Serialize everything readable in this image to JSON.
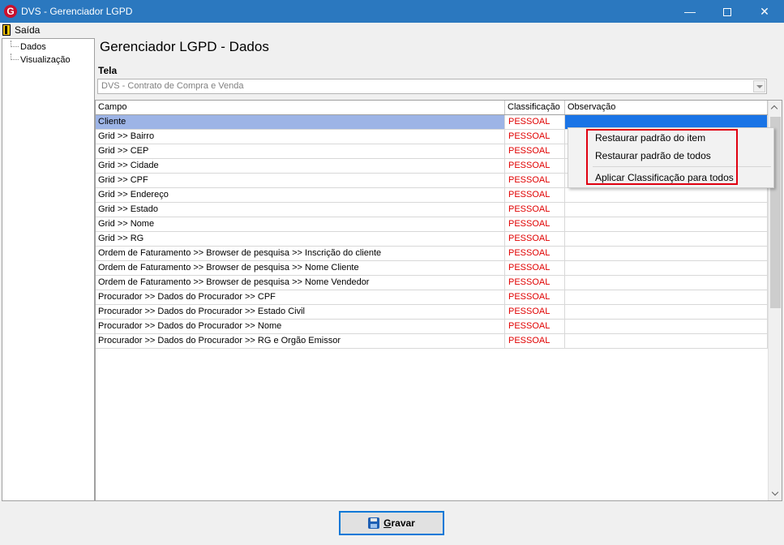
{
  "window": {
    "title": "DVS - Gerenciador LGPD",
    "app_icon_letter": "G",
    "minimize_glyph": "—",
    "close_glyph": "✕"
  },
  "menu": {
    "exit_label": "Saída"
  },
  "tree": {
    "items": [
      {
        "label": "Dados"
      },
      {
        "label": "Visualização"
      }
    ]
  },
  "main": {
    "heading": "Gerenciador LGPD - Dados",
    "tela_label": "Tela",
    "tela_value": "DVS - Contrato de Compra e Venda"
  },
  "grid": {
    "columns": [
      "Campo",
      "Classificação",
      "Observação"
    ],
    "rows": [
      {
        "campo": "Cliente",
        "classificacao": "PESSOAL",
        "observacao": ""
      },
      {
        "campo": "Grid >> Bairro",
        "classificacao": "PESSOAL",
        "observacao": ""
      },
      {
        "campo": "Grid >> CEP",
        "classificacao": "PESSOAL",
        "observacao": ""
      },
      {
        "campo": "Grid >> Cidade",
        "classificacao": "PESSOAL",
        "observacao": ""
      },
      {
        "campo": "Grid >> CPF",
        "classificacao": "PESSOAL",
        "observacao": ""
      },
      {
        "campo": "Grid >> Endereço",
        "classificacao": "PESSOAL",
        "observacao": ""
      },
      {
        "campo": "Grid >> Estado",
        "classificacao": "PESSOAL",
        "observacao": ""
      },
      {
        "campo": "Grid >> Nome",
        "classificacao": "PESSOAL",
        "observacao": ""
      },
      {
        "campo": "Grid >> RG",
        "classificacao": "PESSOAL",
        "observacao": ""
      },
      {
        "campo": "Ordem de Faturamento >> Browser de pesquisa >> Inscrição do cliente",
        "classificacao": "PESSOAL",
        "observacao": ""
      },
      {
        "campo": "Ordem de Faturamento >> Browser de pesquisa >> Nome Cliente",
        "classificacao": "PESSOAL",
        "observacao": ""
      },
      {
        "campo": "Ordem de Faturamento >> Browser de pesquisa >> Nome Vendedor",
        "classificacao": "PESSOAL",
        "observacao": ""
      },
      {
        "campo": "Procurador >> Dados do Procurador >> CPF",
        "classificacao": "PESSOAL",
        "observacao": ""
      },
      {
        "campo": "Procurador >> Dados do Procurador >> Estado Civil",
        "classificacao": "PESSOAL",
        "observacao": ""
      },
      {
        "campo": "Procurador >> Dados do Procurador >> Nome",
        "classificacao": "PESSOAL",
        "observacao": ""
      },
      {
        "campo": "Procurador >> Dados do Procurador >> RG e Orgão Emissor",
        "classificacao": "PESSOAL",
        "observacao": ""
      }
    ],
    "selected_row": 0
  },
  "context_menu": {
    "items": [
      {
        "label": "Restaurar padrão do item"
      },
      {
        "label": "Restaurar padrão de todos"
      },
      {
        "label": "Aplicar Classificação para todos"
      }
    ]
  },
  "footer": {
    "save_label_first": "G",
    "save_label_rest": "ravar"
  },
  "colors": {
    "titlebar": "#2b78bf",
    "classification_text": "#e00000",
    "selected_row": "#9db4e6",
    "highlight_box": "#e00010"
  }
}
